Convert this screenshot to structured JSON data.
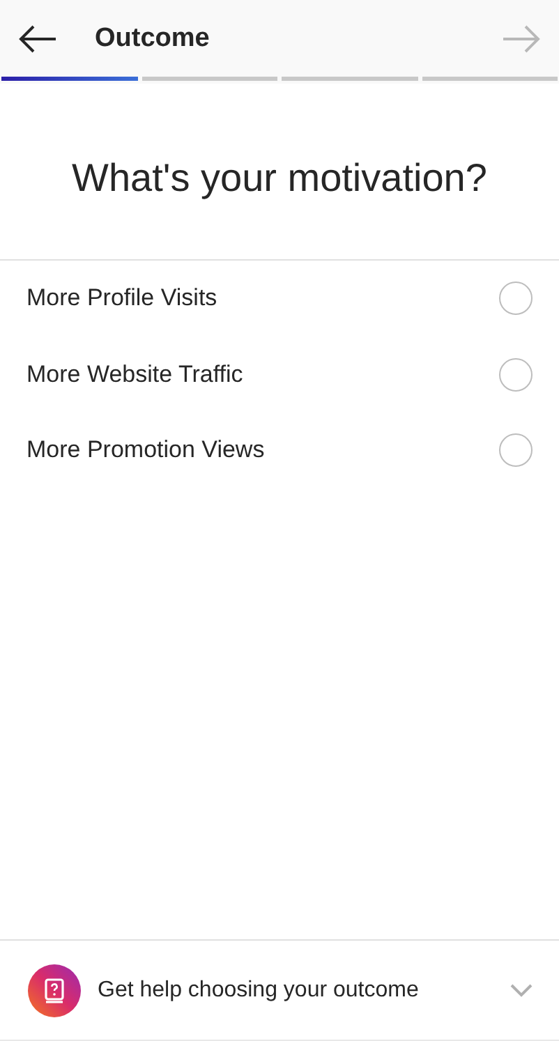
{
  "header": {
    "title": "Outcome",
    "next_disabled": true
  },
  "progress": [
    {
      "active": true
    },
    {
      "active": false
    },
    {
      "active": false
    },
    {
      "active": false
    }
  ],
  "question": "What's your motivation?",
  "options": [
    {
      "label": "More Profile Visits",
      "selected": false
    },
    {
      "label": "More Website Traffic",
      "selected": false
    },
    {
      "label": "More Promotion Views",
      "selected": false
    }
  ],
  "help": {
    "label": "Get help choosing your outcome",
    "expanded": false
  }
}
